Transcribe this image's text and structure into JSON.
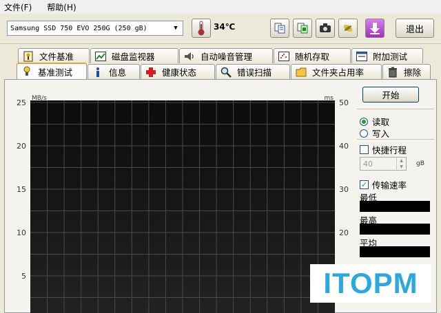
{
  "menu": [
    "文件(F)",
    "帮助(H)"
  ],
  "toolbar": {
    "drive": "Samsung SSD 750 EVO 250G (250 gB)",
    "temperature": "34℃",
    "exit_label": "退出"
  },
  "tabs_top": [
    {
      "label": "文件基准",
      "icon": "file-benchmark-icon"
    },
    {
      "label": "磁盘监视器",
      "icon": "disk-monitor-icon"
    },
    {
      "label": "自动噪音管理",
      "icon": "speaker-icon"
    },
    {
      "label": "随机存取",
      "icon": "random-access-icon"
    },
    {
      "label": "附加测试",
      "icon": "extra-tests-icon"
    }
  ],
  "tabs_bottom": [
    {
      "label": "基准测试",
      "icon": "benchmark-icon",
      "active": true
    },
    {
      "label": "信息",
      "icon": "info-icon"
    },
    {
      "label": "健康状态",
      "icon": "health-cross-icon"
    },
    {
      "label": "错误扫描",
      "icon": "magnifier-icon"
    },
    {
      "label": "文件夹占用率",
      "icon": "folder-usage-icon"
    },
    {
      "label": "擦除",
      "icon": "trash-icon"
    }
  ],
  "chart_data": {
    "type": "line",
    "ylabel_left": "MB/s",
    "ylabel_right": "ms",
    "y_left_ticks": [
      25,
      20,
      15,
      10,
      5
    ],
    "y_right_ticks": [
      50,
      40,
      30,
      20
    ],
    "ylim_left": [
      0,
      25
    ],
    "ylim_right": [
      0,
      50
    ],
    "grid": true,
    "series": []
  },
  "side": {
    "start_label": "开始",
    "read_label": "读取",
    "write_label": "写入",
    "short_stroke_label": "快捷行程",
    "short_stroke_value": "40",
    "short_stroke_unit": "gB",
    "transfer_rate_label": "传输速率",
    "min_label": "最低",
    "max_label": "最高",
    "avg_label": "平均"
  },
  "watermark": "ITOPM"
}
